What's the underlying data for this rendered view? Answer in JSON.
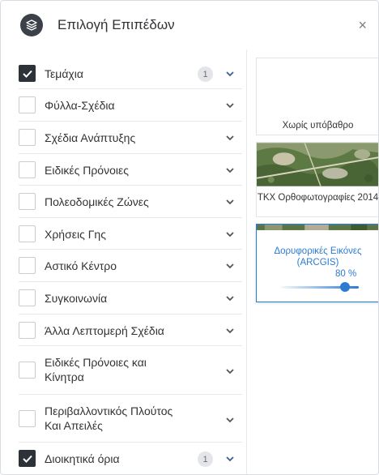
{
  "header": {
    "title": "Επιλογή Επιπέδων",
    "close_label": "×"
  },
  "layers": [
    {
      "label": "Τεμάχια",
      "checked": true,
      "count": "1"
    },
    {
      "label": "Φύλλα-Σχέδια",
      "checked": false
    },
    {
      "label": "Σχέδια Ανάπτυξης",
      "checked": false
    },
    {
      "label": "Ειδικές Πρόνοιες",
      "checked": false
    },
    {
      "label": "Πολεοδομικές Ζώνες",
      "checked": false
    },
    {
      "label": "Χρήσεις Γης",
      "checked": false
    },
    {
      "label": "Αστικό Κέντρο",
      "checked": false
    },
    {
      "label": "Συγκοινωνία",
      "checked": false
    },
    {
      "label": "Άλλα Λεπτομερή Σχέδια",
      "checked": false
    },
    {
      "label": "Ειδικές Πρόνοιες και Κίνητρα",
      "checked": false
    },
    {
      "label": "Περιβαλλοντικός Πλούτος Και Απειλές",
      "checked": false
    },
    {
      "label": "Διοικητικά όρια",
      "checked": true,
      "count": "1"
    }
  ],
  "basemaps": [
    {
      "caption": "Χωρίς υπόβαθρο",
      "selected": false
    },
    {
      "caption": "ΤΚΧ Ορθοφωτογραφίες 2014",
      "selected": false
    },
    {
      "caption": "Δορυφορικές Εικόνες (ARCGIS)",
      "selected": true,
      "opacity_label": "80 %",
      "opacity": 0.8
    }
  ],
  "colors": {
    "accent": "#2b7bd3",
    "checkbox_checked": "#2d3138"
  },
  "icons": {
    "header": "layers-icon",
    "close": "close-icon",
    "expand": "chevron-down-icon",
    "check": "check-icon"
  }
}
